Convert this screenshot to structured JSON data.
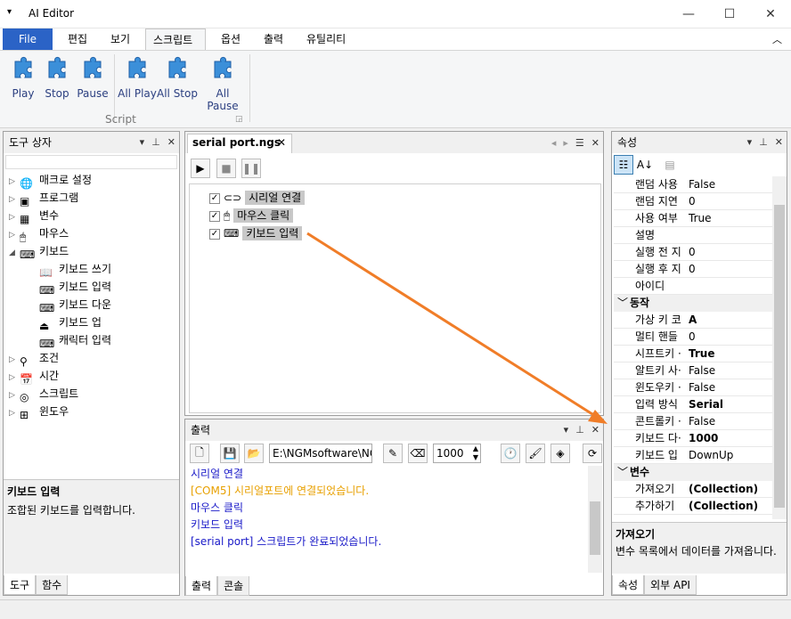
{
  "title": "AI Editor",
  "ribbon": {
    "file_label": "File",
    "tabs": [
      "편집",
      "보기",
      "스크립트",
      "옵션",
      "출력",
      "유틸리티"
    ],
    "buttons": [
      "Play",
      "Stop",
      "Pause",
      "All Play",
      "All Stop",
      "All Pause"
    ],
    "group_label": "Script"
  },
  "toolbox": {
    "title": "도구 상자",
    "items": [
      "매크로 설정",
      "프로그램",
      "변수",
      "마우스",
      "키보드",
      "키보드 쓰기",
      "키보드 입력",
      "키보드 다운",
      "키보드 업",
      "캐릭터 입력",
      "조건",
      "시간",
      "스크립트",
      "윈도우"
    ],
    "desc_title": "키보드 입력",
    "desc_text": "조합된 키보드를 입력합니다.",
    "tabs": [
      "도구",
      "함수"
    ]
  },
  "editor": {
    "tab_label": "serial port.ngs",
    "nodes": [
      "시리얼 연결",
      "마우스 클릭",
      "키보드 입력"
    ]
  },
  "output": {
    "title": "출력",
    "path": "E:\\NGMsoftware\\NG",
    "number": "1000",
    "lines": [
      "시리얼 연결",
      "[COM5] 시리얼포트에 연결되었습니다.",
      "마우스 클릭",
      "키보드 입력",
      "[serial port] 스크립트가 완료되었습니다."
    ],
    "tabs": [
      "출력",
      "콘솔"
    ]
  },
  "properties": {
    "title": "속성",
    "rows1": [
      [
        "랜덤 사용",
        "False"
      ],
      [
        "랜덤 지연",
        "0"
      ],
      [
        "사용 여부",
        "True"
      ],
      [
        "설명",
        ""
      ],
      [
        "실행 전 지",
        "0"
      ],
      [
        "실행 후 지",
        "0"
      ],
      [
        "아이디",
        ""
      ]
    ],
    "cat2": "동작",
    "rows2": [
      [
        "가상 키 코",
        "A"
      ],
      [
        "멀티 핸들",
        "0"
      ],
      [
        "시프트키 ·",
        "True"
      ],
      [
        "알트키 사·",
        "False"
      ],
      [
        "윈도우키 ·",
        "False"
      ],
      [
        "입력 방식",
        "Serial"
      ],
      [
        "콘트롤키 ·",
        "False"
      ],
      [
        "키보드 다·",
        "1000"
      ],
      [
        "키보드 입",
        "DownUp"
      ]
    ],
    "cat3": "변수",
    "rows3": [
      [
        "가져오기",
        "(Collection)"
      ],
      [
        "추가하기",
        "(Collection)"
      ]
    ],
    "desc_title": "가져오기",
    "desc_text": "변수 목록에서 데이터를 가져옵니다.",
    "tabs": [
      "속성",
      "외부 API"
    ]
  }
}
